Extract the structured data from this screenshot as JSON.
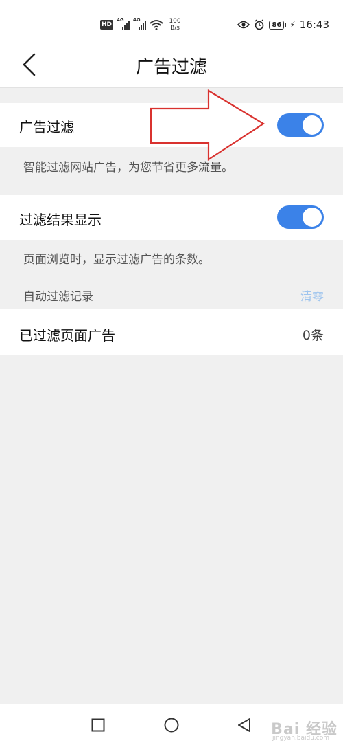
{
  "status_bar": {
    "hd": "HD",
    "net1": "4G",
    "net2": "4G",
    "speed_value": "100",
    "speed_unit": "B/s",
    "battery": "86",
    "time": "16:43"
  },
  "header": {
    "title": "广告过滤"
  },
  "ad_filter": {
    "label": "广告过滤",
    "enabled": true,
    "description": "智能过滤网站广告，为您节省更多流量。"
  },
  "result_display": {
    "label": "过滤结果显示",
    "enabled": true,
    "description": "页面浏览时，显示过滤广告的条数。"
  },
  "records": {
    "section_label": "自动过滤记录",
    "clear_label": "清零",
    "item_label": "已过滤页面广告",
    "item_value": "0条"
  },
  "watermark": {
    "text": "Bai 经验",
    "sub": "jingyan.baidu.com"
  },
  "colors": {
    "toggle_on": "#3b82e8",
    "clear_link": "#9ec4ee",
    "annotation_arrow": "#d9322f"
  }
}
